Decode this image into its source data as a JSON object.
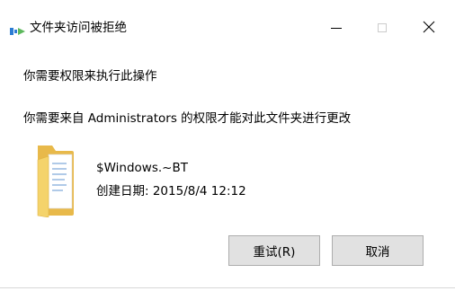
{
  "window": {
    "title": "文件夹访问被拒绝",
    "minimize_icon": "minimize-icon",
    "maximize_icon": "maximize-icon",
    "close_glyph": "X"
  },
  "content": {
    "heading": "你需要权限来执行此操作",
    "message": "你需要来自 Administrators 的权限才能对此文件夹进行更改",
    "folder": {
      "icon": "folder-icon",
      "name": "$Windows.~BT",
      "date_label": "创建日期",
      "date_value": "2015/8/4 12:12",
      "date_line": "创建日期: 2015/8/4 12:12"
    }
  },
  "buttons": {
    "retry_label": "重试(R)",
    "cancel_label": "取消"
  },
  "colors": {
    "button_bg": "#e1e1e1",
    "button_border": "#adadad",
    "folder_yellow": "#f4d36b",
    "icon_blue": "#2b7cd3",
    "icon_green": "#5cb85c"
  }
}
